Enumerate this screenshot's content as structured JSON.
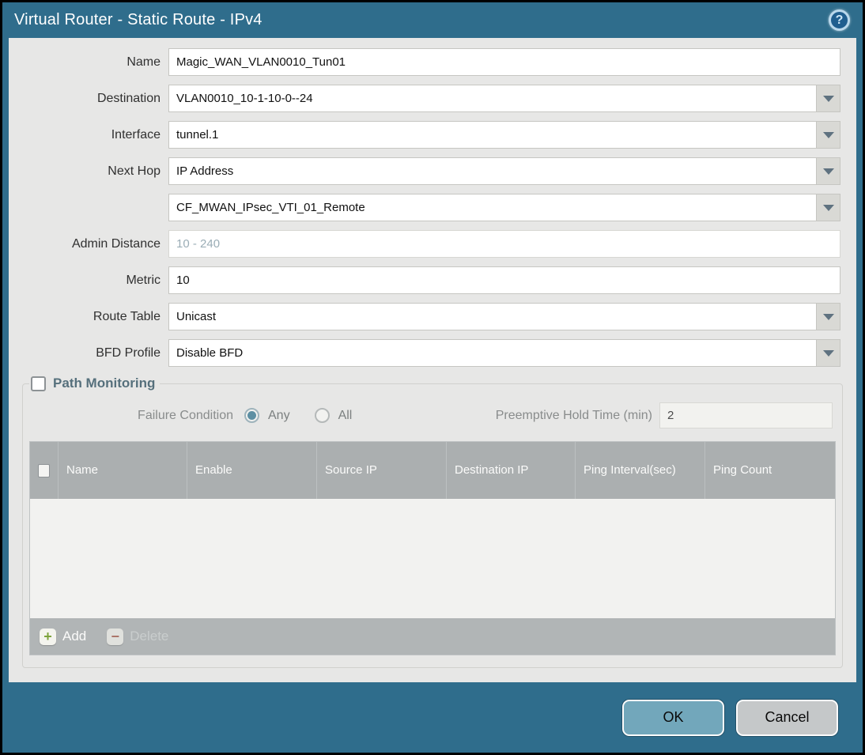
{
  "dialog": {
    "title": "Virtual Router - Static Route - IPv4",
    "help_glyph": "?"
  },
  "form": {
    "name": {
      "label": "Name",
      "value": "Magic_WAN_VLAN0010_Tun01"
    },
    "destination": {
      "label": "Destination",
      "value": "VLAN0010_10-1-10-0--24"
    },
    "interface": {
      "label": "Interface",
      "value": "tunnel.1"
    },
    "next_hop": {
      "label": "Next Hop",
      "value": "IP Address"
    },
    "next_hop_address": {
      "value": "CF_MWAN_IPsec_VTI_01_Remote"
    },
    "admin_distance": {
      "label": "Admin Distance",
      "placeholder": "10 - 240"
    },
    "metric": {
      "label": "Metric",
      "value": "10"
    },
    "route_table": {
      "label": "Route Table",
      "value": "Unicast"
    },
    "bfd_profile": {
      "label": "BFD Profile",
      "value": "Disable BFD"
    }
  },
  "path_monitoring": {
    "title": "Path Monitoring",
    "enabled": false,
    "failure_condition": {
      "label": "Failure Condition",
      "options": [
        {
          "label": "Any",
          "selected": true
        },
        {
          "label": "All",
          "selected": false
        }
      ]
    },
    "preemptive_hold_time": {
      "label": "Preemptive Hold Time (min)",
      "value": "2"
    },
    "table": {
      "columns": [
        "Name",
        "Enable",
        "Source IP",
        "Destination IP",
        "Ping Interval(sec)",
        "Ping Count"
      ],
      "rows": []
    },
    "actions": {
      "add_label": "Add",
      "add_glyph": "+",
      "delete_label": "Delete",
      "delete_glyph": "−"
    }
  },
  "footer": {
    "ok_label": "OK",
    "cancel_label": "Cancel"
  },
  "colors": {
    "titlebar": "#2f6d8c",
    "content_bg": "#e7e7e6",
    "table_header": "#abafb0",
    "table_footer": "#b1b5b6",
    "ok_button": "#72a7bb",
    "cancel_button": "#c5c8c9",
    "radio_selected": "#5d8fa3",
    "add_icon_green": "#7da33c",
    "delete_icon_red": "#aa6a5c"
  }
}
